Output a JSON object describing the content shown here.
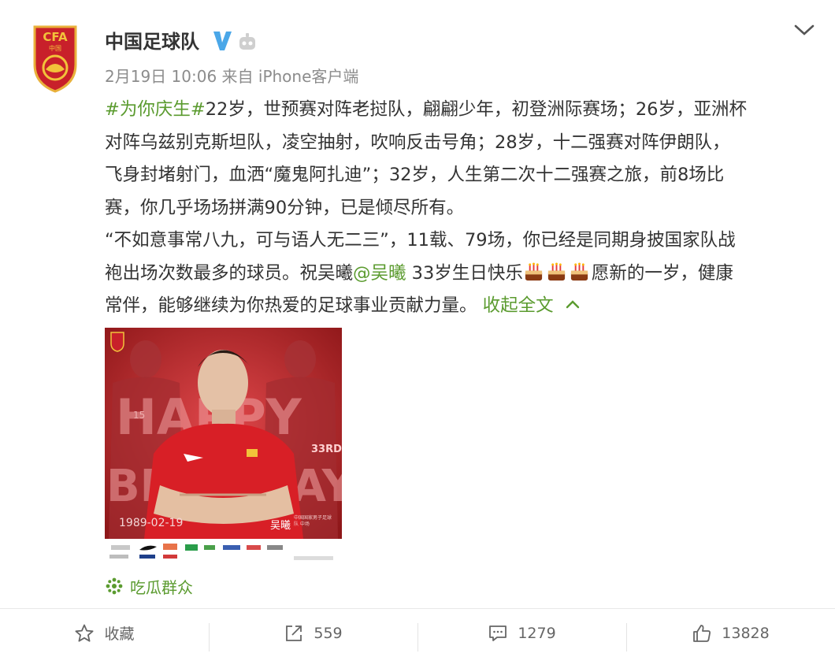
{
  "post": {
    "author": "中国足球队",
    "date": "2月19日 10:06",
    "source_prefix": "来自",
    "client": "iPhone客户端",
    "avatar_text": "CFA",
    "avatar_sub": "中国",
    "lines": {
      "l1_hashtag": "#为你庆生#",
      "l1_text": "22岁，世预赛对阵老挝队，翩翩少年，初登洲际赛场；26岁，亚洲杯",
      "l2": "对阵乌兹别克斯坦队，凌空抽射，吹响反击号角；28岁，十二强赛对阵伊朗队，",
      "l3": "飞身封堵射门，血洒“魔鬼阿扎迪”；32岁，人生第二次十二强赛之旅，前8场比",
      "l4": "赛，你几乎场场拼满90分钟，已是倾尽所有。",
      "l5": "“不如意事常八九，可与语人无二三”，11载、79场，你已经是同期身披国家队战",
      "l6_pre": "袍出场次数最多的球员。祝吴曦",
      "l6_mention": "@吴曦",
      "l6_post": " 33岁生日快乐",
      "l6_tail": "愿新的一岁，健康",
      "l7": "常伴，能够继续为你热爱的足球事业贡献力量。",
      "collapse": "收起全文"
    },
    "poster": {
      "date": "1989-02-19",
      "name": "吴曦",
      "subtitle": "中国国家男子足球队 中场",
      "word1": "HAPPY",
      "word2": "BIRTHDAY",
      "age": "33RD",
      "number": "15"
    },
    "source_tag": "吃瓜群众"
  },
  "actions": {
    "favorite": "收藏",
    "repost": "559",
    "comment": "1279",
    "like": "13828"
  },
  "colors": {
    "link": "#5b9b2f",
    "verified": "#4aa7e8",
    "poster_red": "#c0282c"
  }
}
